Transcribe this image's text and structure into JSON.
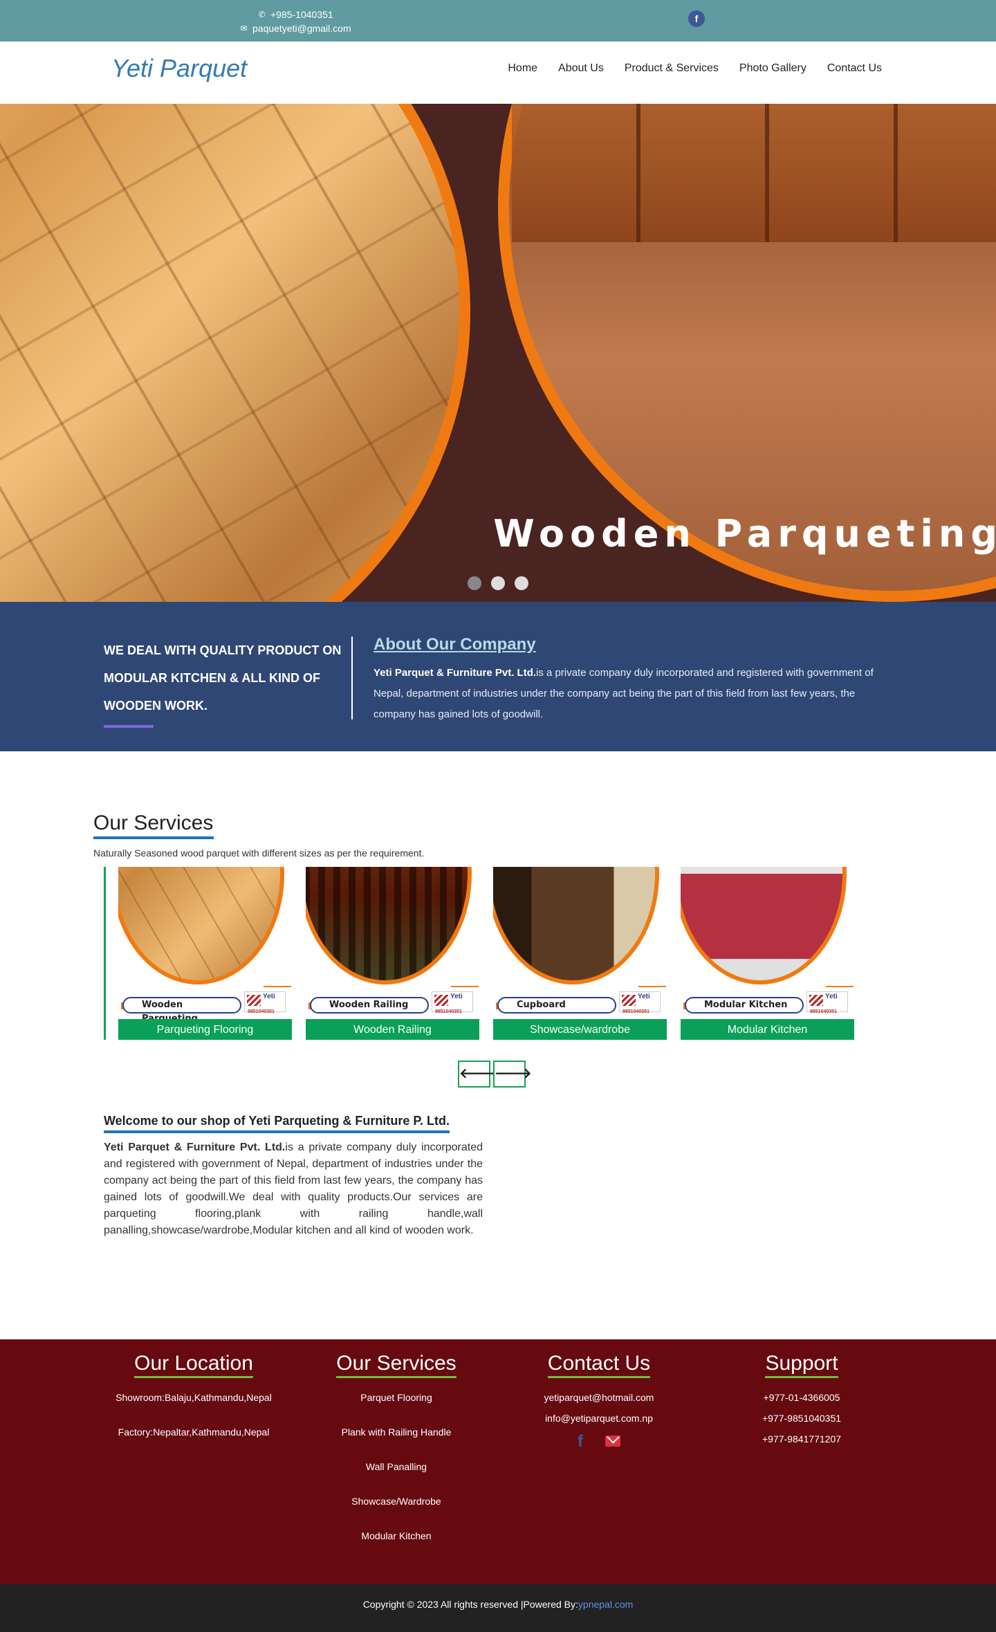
{
  "topbar": {
    "phone": "+985-1040351",
    "email": "paquetyeti@gmail.com",
    "facebook_glyph": "f"
  },
  "header": {
    "brand": "Yeti Parquet",
    "nav": [
      "Home",
      "About Us",
      "Product & Services",
      "Photo Gallery",
      "Contact Us"
    ]
  },
  "hero": {
    "caption": "Wooden Parqueting",
    "slide_count": 3,
    "active_slide": 1
  },
  "about": {
    "tagline": "WE DEAL WITH QUALITY PRODUCT ON MODULAR KITCHEN & ALL KIND OF WOODEN WORK.",
    "heading": "About Our Company",
    "company": "Yeti Parquet & Furniture Pvt. Ltd.",
    "text": "is a private company duly incorporated and registered with government of Nepal, department of industries under the company act being the part of this field from last few years, the company has gained lots of goodwill."
  },
  "services": {
    "title": "Our Services",
    "subtitle": "Naturally Seasoned wood parquet with different sizes as per the requirement.",
    "cards": [
      {
        "banner": "Wooden Parqueting",
        "label": "Parqueting Flooring"
      },
      {
        "banner": "Wooden Railing",
        "label": "Wooden Railing"
      },
      {
        "banner": "Cupboard",
        "label": "Showcase/wardrobe"
      },
      {
        "banner": "Modular Kitchen",
        "label": "Modular Kitchen"
      }
    ],
    "logo_text": "Yeti",
    "logo_phone": "9851040351",
    "prev_glyph": "🡐",
    "next_glyph": "🡒"
  },
  "welcome": {
    "title": "Welcome to our shop of Yeti Parqueting & Furniture P. Ltd.",
    "company": "Yeti Parquet & Furniture Pvt. Ltd.",
    "text": "is a private company duly incorporated and registered with government of Nepal, department of industries under the company act being the part of this field from last few years, the company has gained lots of goodwill.We deal with quality products.Our services are parqueting flooring,plank with railing handle,wall panalling,showcase/wardrobe,Modular kitchen and all kind of wooden work."
  },
  "footer": {
    "location": {
      "title": "Our Location",
      "items": [
        "Showroom:Balaju,Kathmandu,Nepal",
        "Factory:Nepaltar,Kathmandu,Nepal"
      ]
    },
    "services": {
      "title": "Our Services",
      "items": [
        "Parquet Flooring",
        "Plank with Railing Handle",
        "Wall Panalling",
        "Showcase/Wardrobe",
        "Modular Kitchen"
      ]
    },
    "contact": {
      "title": "Contact Us",
      "items": [
        "yetiparquet@hotmail.com",
        "info@yetiparquet.com.np"
      ]
    },
    "support": {
      "title": "Support",
      "items": [
        "+977-01-4366005",
        "+977-9851040351",
        "+977-9841771207"
      ]
    }
  },
  "copyright": {
    "text": "Copyright © 2023 All rights reserved |Powered By:",
    "link": "ypnepal.com"
  },
  "colors": {
    "topbar": "#5f9ba0",
    "brand": "#337ab7",
    "about_band": "#2f4775",
    "service_label": "#0aa05a",
    "footer": "#660a10",
    "accent_orange": "#f07a12"
  }
}
